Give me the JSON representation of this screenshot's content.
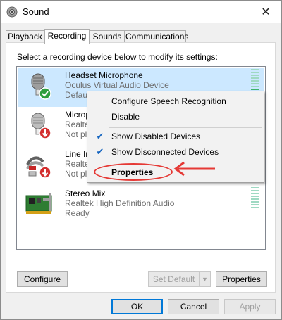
{
  "window": {
    "title": "Sound",
    "close_glyph": "✕"
  },
  "tabs": [
    {
      "label": "Playback",
      "active": false
    },
    {
      "label": "Recording",
      "active": true
    },
    {
      "label": "Sounds",
      "active": false
    },
    {
      "label": "Communications",
      "active": false
    }
  ],
  "instruction": "Select a recording device below to modify its settings:",
  "devices": [
    {
      "name": "Headset Microphone",
      "driver": "Oculus Virtual Audio Device",
      "status": "Default Device",
      "icon": "headset-mic-icon",
      "badge": "green-check",
      "selected": true
    },
    {
      "name": "Microphone",
      "driver": "Realtek High Definition Audio",
      "status": "Not plugged in",
      "icon": "microphone-icon",
      "badge": "red-down-arrow",
      "selected": false
    },
    {
      "name": "Line In",
      "driver": "Realtek High Definition Audio",
      "status": "Not plugged in",
      "icon": "line-in-icon",
      "badge": "red-down-arrow",
      "selected": false
    },
    {
      "name": "Stereo Mix",
      "driver": "Realtek High Definition Audio",
      "status": "Ready",
      "icon": "sound-card-icon",
      "badge": "",
      "selected": false
    }
  ],
  "context_menu": {
    "items": [
      {
        "label": "Configure Speech Recognition",
        "checked": false,
        "bold": false
      },
      {
        "label": "Disable",
        "checked": false,
        "bold": false
      },
      {
        "label": "Show Disabled Devices",
        "checked": true,
        "bold": false
      },
      {
        "label": "Show Disconnected Devices",
        "checked": true,
        "bold": false
      },
      {
        "label": "Properties",
        "checked": false,
        "bold": true
      }
    ],
    "check_glyph": "✔"
  },
  "buttons": {
    "configure": "Configure",
    "set_default": "Set Default",
    "properties": "Properties",
    "ok": "OK",
    "cancel": "Cancel",
    "apply": "Apply"
  },
  "colors": {
    "accent": "#0078d7",
    "selection": "#cce8ff",
    "annotation": "#e53935",
    "level_meter": "#9fd9c3"
  }
}
